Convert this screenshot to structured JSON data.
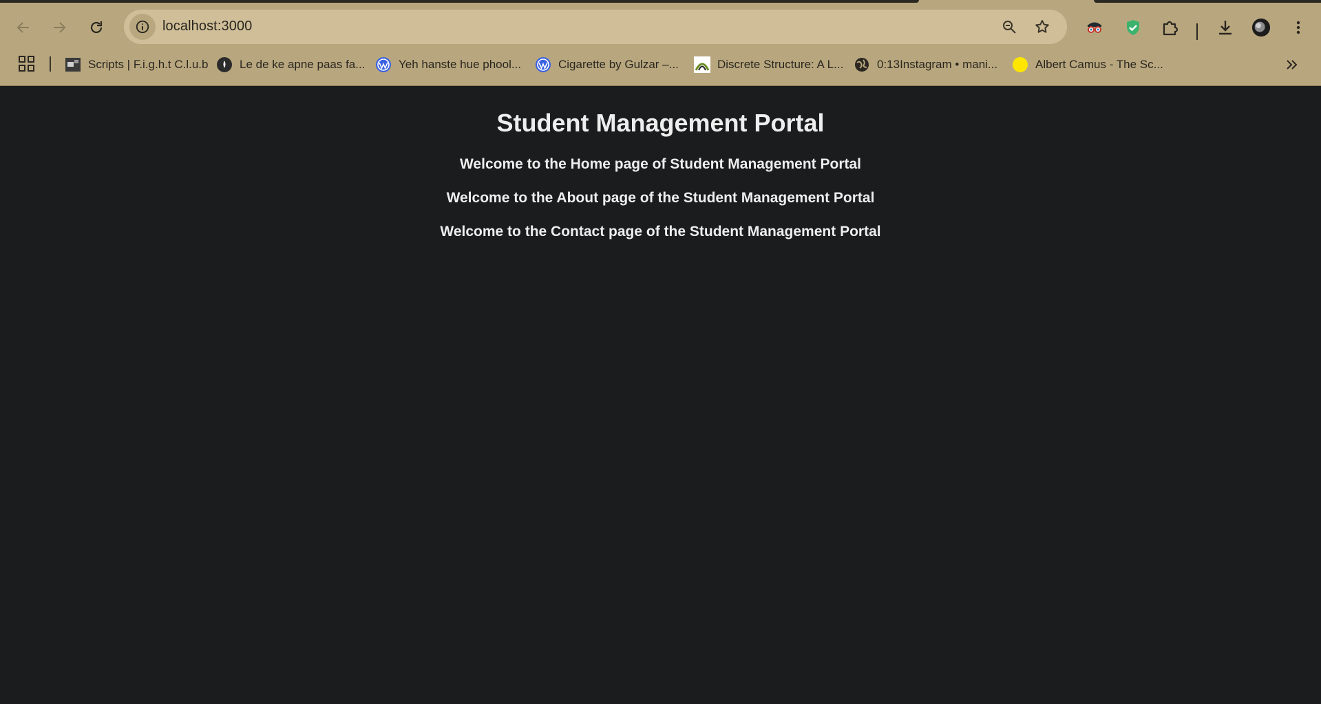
{
  "browser": {
    "url": "localhost:3000",
    "bookmarks": [
      {
        "label": "Scripts | F.i.g.h.t C.l.u.b",
        "icon": "film-thumbnail-icon"
      },
      {
        "label": "Le de ke apne paas fa...",
        "icon": "site-dark-circle-icon"
      },
      {
        "label": "Yeh hanste hue phool...",
        "icon": "wordpress-icon"
      },
      {
        "label": "Cigarette by Gulzar –...",
        "icon": "wordpress-icon"
      },
      {
        "label": "Discrete Structure: A L...",
        "icon": "arch-logo-icon"
      },
      {
        "label": "0:13Instagram • mani...",
        "icon": "globe-icon"
      },
      {
        "label": "Albert Camus - The Sc...",
        "icon": "yellow-circle-icon"
      }
    ],
    "colors": {
      "chrome": "#b8a77e",
      "omnibox": "#cfbe98",
      "page_background": "#1b1c1e",
      "page_text": "#eeeeee"
    }
  },
  "page": {
    "title": "Student Management Portal",
    "lines": [
      "Welcome to the Home page of Student Management Portal",
      "Welcome to the About page of the Student Management Portal",
      "Welcome to the Contact page of the Student Management Portal"
    ]
  }
}
